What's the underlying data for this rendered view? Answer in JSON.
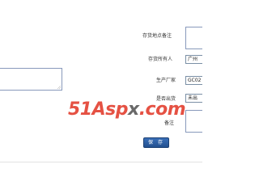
{
  "form": {
    "storage_location_note_label": "存货地点备注",
    "owner_label": "存货所有人",
    "owner_value": "广州",
    "manufacturer_label": "生产厂家",
    "manufacturer_value": "GC02",
    "outbound_label": "是否出货",
    "outbound_value": "未出",
    "note_label": "备注",
    "save_label": "保 存"
  },
  "watermark": {
    "red_text": "51Asp",
    "dark_text": "x",
    "tail_text": ".com"
  },
  "colors": {
    "button": "#2c5da0",
    "watermark": "#e23a2a",
    "input_border": "#7a8fa5"
  }
}
